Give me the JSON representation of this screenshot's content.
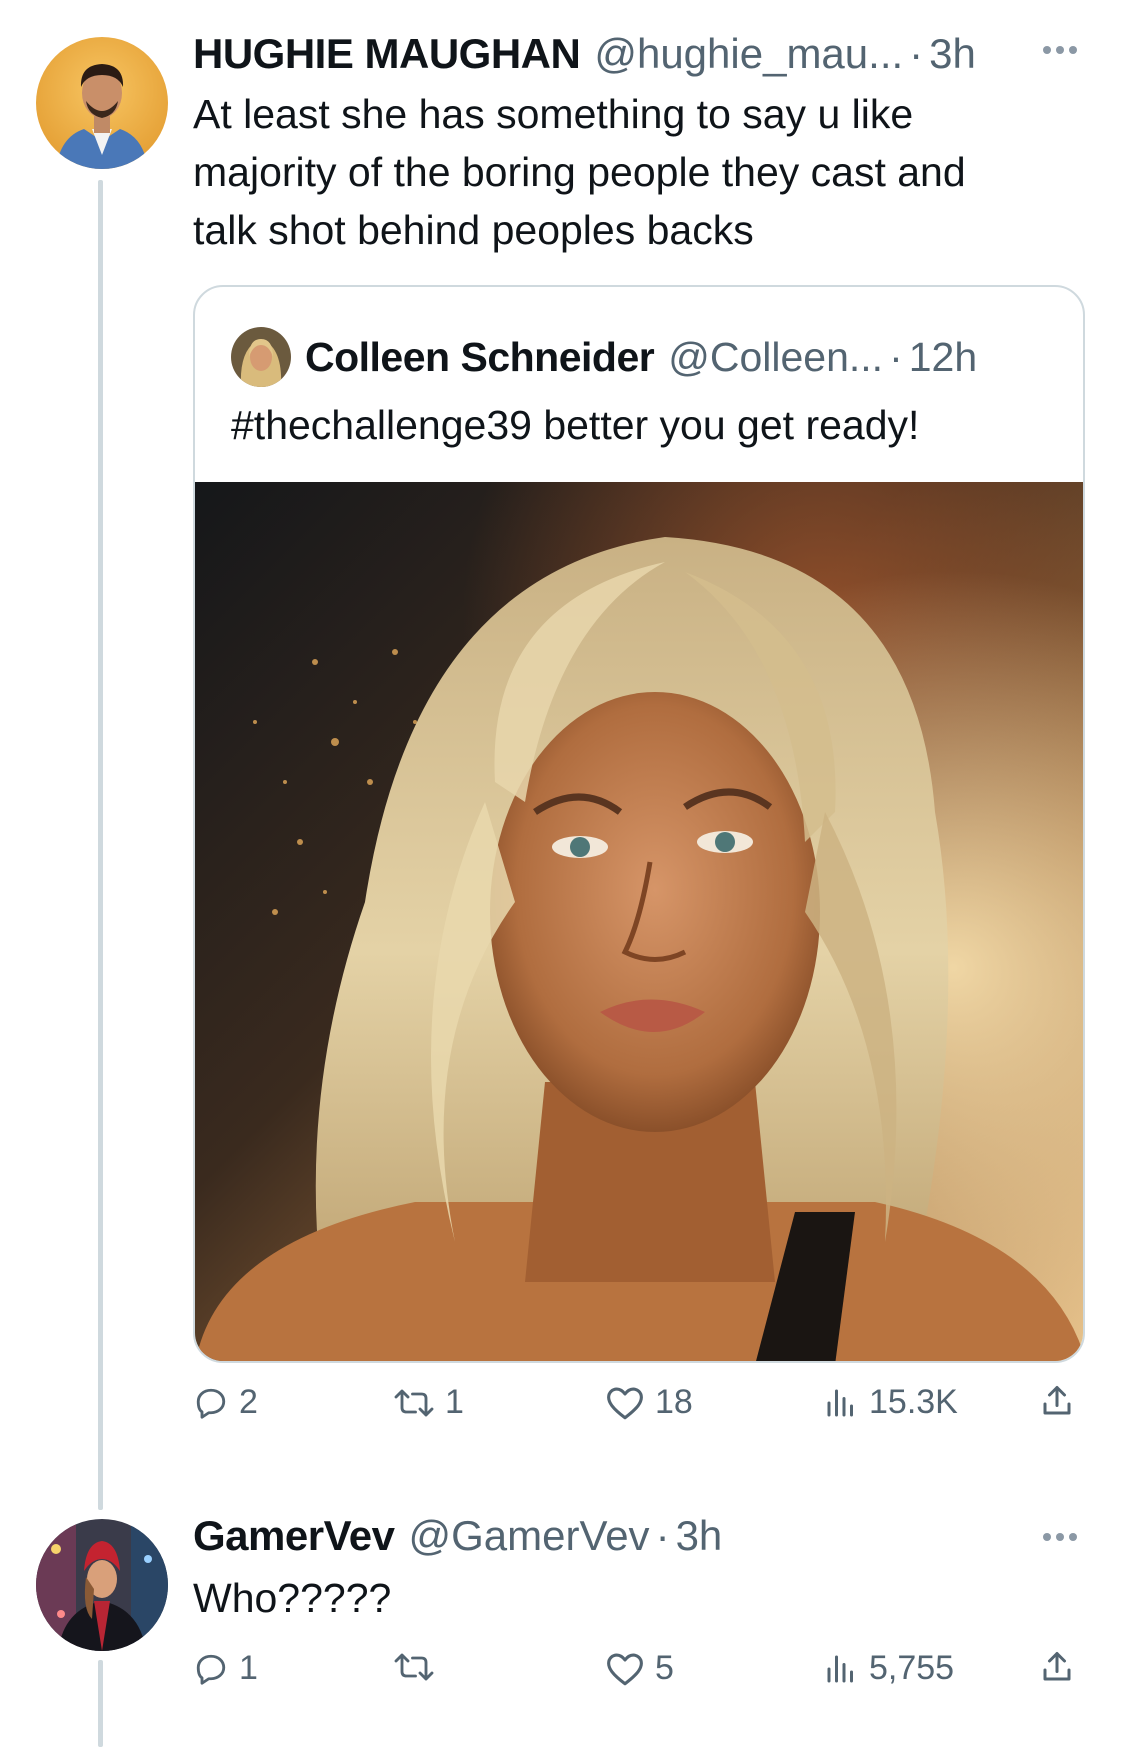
{
  "tweets": [
    {
      "name": "HUGHIE MAUGHAN",
      "handle": "@hughie_mau...",
      "separator": "·",
      "time": "3h",
      "text_lines": [
        "At least she has something to say u like",
        "majority of the boring people they cast and",
        "talk shot behind peoples backs"
      ],
      "quote": {
        "name": "Colleen Schneider",
        "handle": "@Colleen...",
        "separator": "·",
        "time": "12h",
        "text": "#thechallenge39 better you get ready!"
      },
      "actions": {
        "replies": "2",
        "retweets": "1",
        "likes": "18",
        "views": "15.3K"
      }
    },
    {
      "name": "GamerVev",
      "handle": "@GamerVev",
      "separator": "·",
      "time": "3h",
      "text": "Who?????",
      "actions": {
        "replies": "1",
        "retweets": "",
        "likes": "5",
        "views": "5,755"
      }
    }
  ],
  "icons": {
    "reply": "reply-icon",
    "retweet": "retweet-icon",
    "like": "heart-icon",
    "views": "views-chart-icon",
    "share": "share-icon",
    "more": "more-dots-icon"
  },
  "colors": {
    "text": "#0f1419",
    "secondary": "#536471",
    "border": "#cfd9de"
  }
}
